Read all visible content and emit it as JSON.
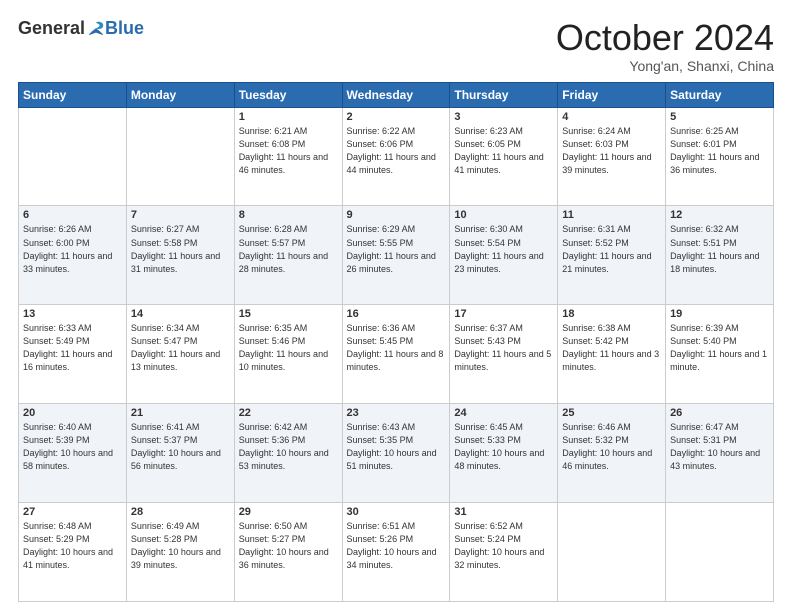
{
  "header": {
    "logo_general": "General",
    "logo_blue": "Blue",
    "month_title": "October 2024",
    "subtitle": "Yong'an, Shanxi, China"
  },
  "days_of_week": [
    "Sunday",
    "Monday",
    "Tuesday",
    "Wednesday",
    "Thursday",
    "Friday",
    "Saturday"
  ],
  "weeks": [
    [
      {
        "day": "",
        "sunrise": "",
        "sunset": "",
        "daylight": ""
      },
      {
        "day": "",
        "sunrise": "",
        "sunset": "",
        "daylight": ""
      },
      {
        "day": "1",
        "sunrise": "Sunrise: 6:21 AM",
        "sunset": "Sunset: 6:08 PM",
        "daylight": "Daylight: 11 hours and 46 minutes."
      },
      {
        "day": "2",
        "sunrise": "Sunrise: 6:22 AM",
        "sunset": "Sunset: 6:06 PM",
        "daylight": "Daylight: 11 hours and 44 minutes."
      },
      {
        "day": "3",
        "sunrise": "Sunrise: 6:23 AM",
        "sunset": "Sunset: 6:05 PM",
        "daylight": "Daylight: 11 hours and 41 minutes."
      },
      {
        "day": "4",
        "sunrise": "Sunrise: 6:24 AM",
        "sunset": "Sunset: 6:03 PM",
        "daylight": "Daylight: 11 hours and 39 minutes."
      },
      {
        "day": "5",
        "sunrise": "Sunrise: 6:25 AM",
        "sunset": "Sunset: 6:01 PM",
        "daylight": "Daylight: 11 hours and 36 minutes."
      }
    ],
    [
      {
        "day": "6",
        "sunrise": "Sunrise: 6:26 AM",
        "sunset": "Sunset: 6:00 PM",
        "daylight": "Daylight: 11 hours and 33 minutes."
      },
      {
        "day": "7",
        "sunrise": "Sunrise: 6:27 AM",
        "sunset": "Sunset: 5:58 PM",
        "daylight": "Daylight: 11 hours and 31 minutes."
      },
      {
        "day": "8",
        "sunrise": "Sunrise: 6:28 AM",
        "sunset": "Sunset: 5:57 PM",
        "daylight": "Daylight: 11 hours and 28 minutes."
      },
      {
        "day": "9",
        "sunrise": "Sunrise: 6:29 AM",
        "sunset": "Sunset: 5:55 PM",
        "daylight": "Daylight: 11 hours and 26 minutes."
      },
      {
        "day": "10",
        "sunrise": "Sunrise: 6:30 AM",
        "sunset": "Sunset: 5:54 PM",
        "daylight": "Daylight: 11 hours and 23 minutes."
      },
      {
        "day": "11",
        "sunrise": "Sunrise: 6:31 AM",
        "sunset": "Sunset: 5:52 PM",
        "daylight": "Daylight: 11 hours and 21 minutes."
      },
      {
        "day": "12",
        "sunrise": "Sunrise: 6:32 AM",
        "sunset": "Sunset: 5:51 PM",
        "daylight": "Daylight: 11 hours and 18 minutes."
      }
    ],
    [
      {
        "day": "13",
        "sunrise": "Sunrise: 6:33 AM",
        "sunset": "Sunset: 5:49 PM",
        "daylight": "Daylight: 11 hours and 16 minutes."
      },
      {
        "day": "14",
        "sunrise": "Sunrise: 6:34 AM",
        "sunset": "Sunset: 5:47 PM",
        "daylight": "Daylight: 11 hours and 13 minutes."
      },
      {
        "day": "15",
        "sunrise": "Sunrise: 6:35 AM",
        "sunset": "Sunset: 5:46 PM",
        "daylight": "Daylight: 11 hours and 10 minutes."
      },
      {
        "day": "16",
        "sunrise": "Sunrise: 6:36 AM",
        "sunset": "Sunset: 5:45 PM",
        "daylight": "Daylight: 11 hours and 8 minutes."
      },
      {
        "day": "17",
        "sunrise": "Sunrise: 6:37 AM",
        "sunset": "Sunset: 5:43 PM",
        "daylight": "Daylight: 11 hours and 5 minutes."
      },
      {
        "day": "18",
        "sunrise": "Sunrise: 6:38 AM",
        "sunset": "Sunset: 5:42 PM",
        "daylight": "Daylight: 11 hours and 3 minutes."
      },
      {
        "day": "19",
        "sunrise": "Sunrise: 6:39 AM",
        "sunset": "Sunset: 5:40 PM",
        "daylight": "Daylight: 11 hours and 1 minute."
      }
    ],
    [
      {
        "day": "20",
        "sunrise": "Sunrise: 6:40 AM",
        "sunset": "Sunset: 5:39 PM",
        "daylight": "Daylight: 10 hours and 58 minutes."
      },
      {
        "day": "21",
        "sunrise": "Sunrise: 6:41 AM",
        "sunset": "Sunset: 5:37 PM",
        "daylight": "Daylight: 10 hours and 56 minutes."
      },
      {
        "day": "22",
        "sunrise": "Sunrise: 6:42 AM",
        "sunset": "Sunset: 5:36 PM",
        "daylight": "Daylight: 10 hours and 53 minutes."
      },
      {
        "day": "23",
        "sunrise": "Sunrise: 6:43 AM",
        "sunset": "Sunset: 5:35 PM",
        "daylight": "Daylight: 10 hours and 51 minutes."
      },
      {
        "day": "24",
        "sunrise": "Sunrise: 6:45 AM",
        "sunset": "Sunset: 5:33 PM",
        "daylight": "Daylight: 10 hours and 48 minutes."
      },
      {
        "day": "25",
        "sunrise": "Sunrise: 6:46 AM",
        "sunset": "Sunset: 5:32 PM",
        "daylight": "Daylight: 10 hours and 46 minutes."
      },
      {
        "day": "26",
        "sunrise": "Sunrise: 6:47 AM",
        "sunset": "Sunset: 5:31 PM",
        "daylight": "Daylight: 10 hours and 43 minutes."
      }
    ],
    [
      {
        "day": "27",
        "sunrise": "Sunrise: 6:48 AM",
        "sunset": "Sunset: 5:29 PM",
        "daylight": "Daylight: 10 hours and 41 minutes."
      },
      {
        "day": "28",
        "sunrise": "Sunrise: 6:49 AM",
        "sunset": "Sunset: 5:28 PM",
        "daylight": "Daylight: 10 hours and 39 minutes."
      },
      {
        "day": "29",
        "sunrise": "Sunrise: 6:50 AM",
        "sunset": "Sunset: 5:27 PM",
        "daylight": "Daylight: 10 hours and 36 minutes."
      },
      {
        "day": "30",
        "sunrise": "Sunrise: 6:51 AM",
        "sunset": "Sunset: 5:26 PM",
        "daylight": "Daylight: 10 hours and 34 minutes."
      },
      {
        "day": "31",
        "sunrise": "Sunrise: 6:52 AM",
        "sunset": "Sunset: 5:24 PM",
        "daylight": "Daylight: 10 hours and 32 minutes."
      },
      {
        "day": "",
        "sunrise": "",
        "sunset": "",
        "daylight": ""
      },
      {
        "day": "",
        "sunrise": "",
        "sunset": "",
        "daylight": ""
      }
    ]
  ]
}
